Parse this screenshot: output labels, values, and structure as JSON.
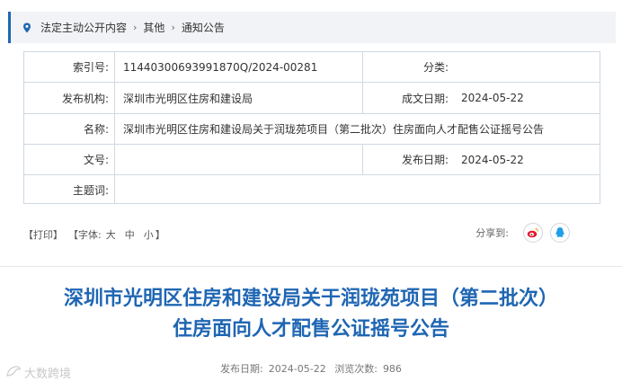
{
  "breadcrumb": [
    "法定主动公开内容",
    "其他",
    "通知公告"
  ],
  "breadcrumb_sep": "›",
  "info": {
    "index_label": "索引号:",
    "index_value": "11440300693991870Q/2024-00281",
    "category_label": "分类:",
    "category_value": "",
    "issuer_label": "发布机构:",
    "issuer_value": "深圳市光明区住房和建设局",
    "created_label": "成文日期:",
    "created_value": "2024-05-22",
    "name_label": "名称:",
    "name_value": "深圳市光明区住房和建设局关于润珑苑项目（第二批次）住房面向人才配售公证摇号公告",
    "docno_label": "文号:",
    "docno_value": "",
    "published_label": "发布日期:",
    "published_value": "2024-05-22",
    "subject_label": "主题词:",
    "subject_value": ""
  },
  "tools": {
    "print": "【打印】",
    "font_prefix": "【字体:",
    "font_large": "大",
    "font_medium": "中",
    "font_small": "小",
    "font_suffix": "】",
    "share_label": "分享到:",
    "share_icons": [
      "weibo-icon",
      "qq-icon"
    ]
  },
  "article": {
    "title_line1": "深圳市光明区住房和建设局关于润珑苑项目（第二批次）",
    "title_line2": "住房面向人才配售公证摇号公告",
    "date_label": "发布日期:",
    "date_value": "2024-05-22",
    "views_label": "浏览次数:",
    "views_value": "986"
  },
  "watermark": "大数跨境",
  "colors": {
    "accent": "#1f66b3",
    "weibo": "#e6162d",
    "qq": "#1fa0e6"
  }
}
